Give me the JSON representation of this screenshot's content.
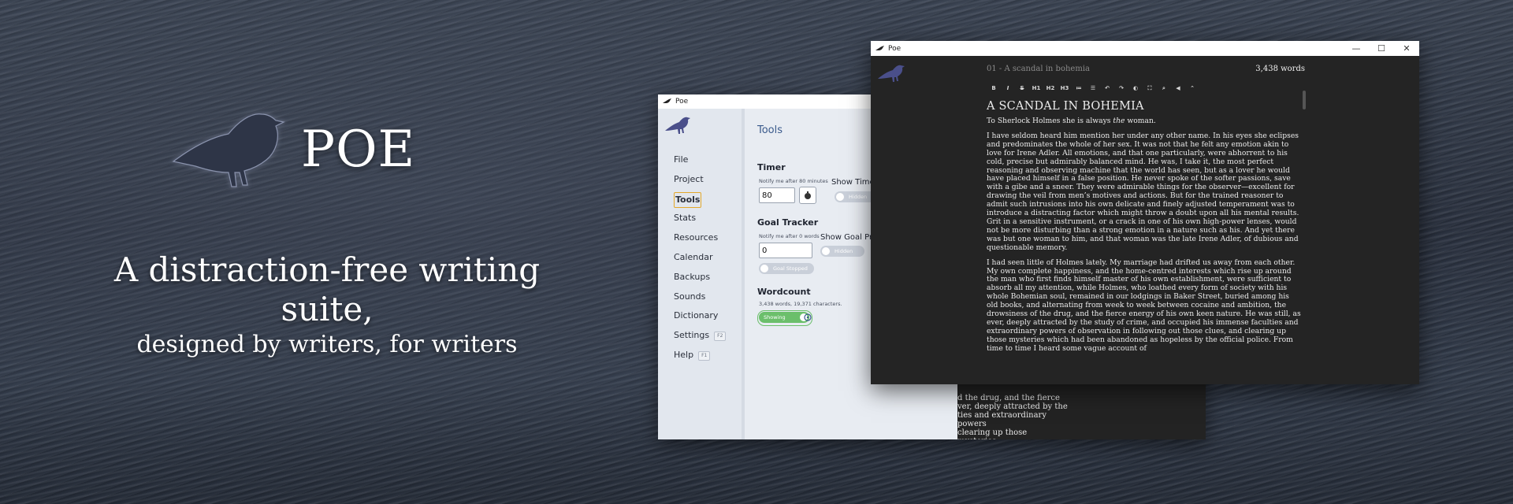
{
  "hero": {
    "brand_name": "POE",
    "tagline_line1": "A distraction-free writing suite,",
    "tagline_line2": "designed by writers, for writers",
    "logo_icon": "raven-icon"
  },
  "light_window": {
    "title": "Poe",
    "sidebar": {
      "items": [
        {
          "label": "File"
        },
        {
          "label": "Project"
        },
        {
          "label": "Tools",
          "active": true
        },
        {
          "label": "Stats"
        },
        {
          "label": "Resources"
        },
        {
          "label": "Calendar"
        },
        {
          "label": "Backups"
        },
        {
          "label": "Sounds"
        },
        {
          "label": "Dictionary"
        },
        {
          "label": "Settings",
          "shortcut": "F2"
        },
        {
          "label": "Help",
          "shortcut": "F1"
        }
      ]
    },
    "tools": {
      "title": "Tools",
      "timer": {
        "heading": "Timer",
        "notify_label": "Notify me after 80 minutes",
        "value": "80",
        "show_label": "Show Timer",
        "toggle_state": "Hidden"
      },
      "goal": {
        "heading": "Goal Tracker",
        "notify_label": "Notify me after 0 words",
        "value": "0",
        "show_label": "Show Goal Prog",
        "toggle_state": "Hidden",
        "status_toggle": "Goal Stopped"
      },
      "wordcount": {
        "heading": "Wordcount",
        "summary": "3,438 words, 19,371 characters.",
        "toggle_state": "Showing"
      }
    },
    "peek_text": [
      "d the drug, and the fierce",
      "ver, deeply attracted by the",
      "ties and extraordinary powers",
      "clearing up those mysteries"
    ]
  },
  "dark_window": {
    "title": "Poe",
    "controls": {
      "minimize": "—",
      "maximize": "☐",
      "close": "✕"
    },
    "chapter": "01 - A scandal in bohemia",
    "wordcount": "3,438 words",
    "toolbar": [
      "B",
      "I",
      "S",
      "H1",
      "H2",
      "H3",
      "≔",
      "☰",
      "↶",
      "↷",
      "◐",
      "⛶",
      "⌕",
      "◀",
      "⌃"
    ],
    "document": {
      "title": "A SCANDAL IN BOHEMIA",
      "intro_prefix": "To Sherlock Holmes she is always ",
      "intro_emph": "the",
      "intro_suffix": " woman.",
      "para1": "I have seldom heard him mention her under any other name. In his eyes she eclipses and predominates the whole of her sex. It was not that he felt any emotion akin to love for Irene Adler. All emotions, and that one particularly, were abhorrent to his cold, precise but admirably balanced mind. He was, I take it, the most perfect reasoning and observing machine that the world has seen, but as a lover he would have placed himself in a false position. He never spoke of the softer passions, save with a gibe and a sneer. They were admirable things for the observer—excellent for drawing the veil from men’s motives and actions. But for the trained reasoner to admit such intrusions into his own delicate and finely adjusted temperament was to introduce a distracting factor which might throw a doubt upon all his mental results. Grit in a sensitive instrument, or a crack in one of his own high-power lenses, would not be more disturbing than a strong emotion in a nature such as his. And yet there was but one woman to him, and that woman was the late Irene Adler, of dubious and questionable memory.",
      "para2": "I had seen little of Holmes lately. My marriage had drifted us away from each other. My own complete happiness, and the home-centred interests which rise up around the man who first finds himself master of his own establishment, were sufficient to absorb all my attention, while Holmes, who loathed every form of society with his whole Bohemian soul, remained in our lodgings in Baker Street, buried among his old books, and alternating from week to week between cocaine and ambition, the drowsiness of the drug, and the fierce energy of his own keen nature. He was still, as ever, deeply attracted by the study of crime, and occupied his immense faculties and extraordinary powers of observation in following out those clues, and clearing up those mysteries which had been abandoned as hopeless by the official police. From time to time I heard some vague account of"
    }
  },
  "colors": {
    "accent_link": "#3a5a8c",
    "active_outline": "#e3a82b",
    "toggle_on": "#6bbf6b",
    "dark_bg": "#242424",
    "raven_purple": "#4a4f8a"
  }
}
